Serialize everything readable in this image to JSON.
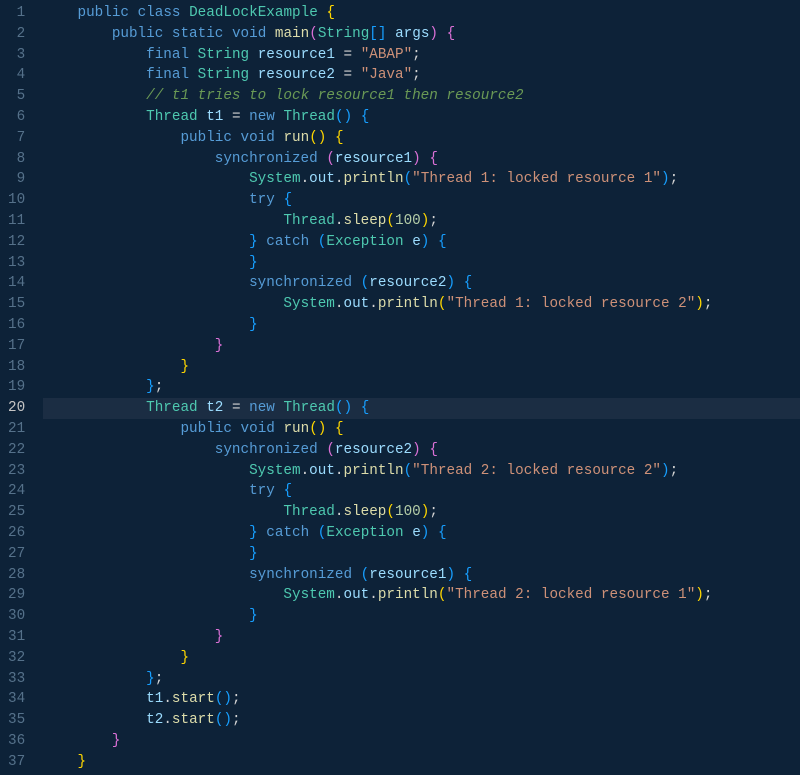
{
  "active_line": 20,
  "lines": [
    {
      "n": 1,
      "indent": 1,
      "tokens": [
        [
          "kw",
          "public"
        ],
        [
          "pn",
          " "
        ],
        [
          "kw",
          "class"
        ],
        [
          "pn",
          " "
        ],
        [
          "cls",
          "DeadLockExample"
        ],
        [
          "pn",
          " "
        ],
        [
          "brc",
          "{"
        ]
      ]
    },
    {
      "n": 2,
      "indent": 2,
      "tokens": [
        [
          "kw",
          "public"
        ],
        [
          "pn",
          " "
        ],
        [
          "kw",
          "static"
        ],
        [
          "pn",
          " "
        ],
        [
          "kw",
          "void"
        ],
        [
          "pn",
          " "
        ],
        [
          "mth",
          "main"
        ],
        [
          "brc2",
          "("
        ],
        [
          "cls",
          "String"
        ],
        [
          "brc3",
          "["
        ],
        [
          "brc3",
          "]"
        ],
        [
          "pn",
          " "
        ],
        [
          "var",
          "args"
        ],
        [
          "brc2",
          ")"
        ],
        [
          "pn",
          " "
        ],
        [
          "brc2",
          "{"
        ]
      ]
    },
    {
      "n": 3,
      "indent": 3,
      "tokens": [
        [
          "kw",
          "final"
        ],
        [
          "pn",
          " "
        ],
        [
          "cls",
          "String"
        ],
        [
          "pn",
          " "
        ],
        [
          "var",
          "resource1"
        ],
        [
          "pn",
          " = "
        ],
        [
          "str",
          "\"ABAP\""
        ],
        [
          "pn",
          ";"
        ]
      ]
    },
    {
      "n": 4,
      "indent": 3,
      "tokens": [
        [
          "kw",
          "final"
        ],
        [
          "pn",
          " "
        ],
        [
          "cls",
          "String"
        ],
        [
          "pn",
          " "
        ],
        [
          "var",
          "resource2"
        ],
        [
          "pn",
          " = "
        ],
        [
          "str",
          "\"Java\""
        ],
        [
          "pn",
          ";"
        ]
      ]
    },
    {
      "n": 5,
      "indent": 3,
      "tokens": [
        [
          "cmt",
          "// t1 tries to lock resource1 then resource2"
        ]
      ]
    },
    {
      "n": 6,
      "indent": 3,
      "tokens": [
        [
          "cls",
          "Thread"
        ],
        [
          "pn",
          " "
        ],
        [
          "var",
          "t1"
        ],
        [
          "pn",
          " = "
        ],
        [
          "kw",
          "new"
        ],
        [
          "pn",
          " "
        ],
        [
          "cls",
          "Thread"
        ],
        [
          "brc3",
          "("
        ],
        [
          "brc3",
          ")"
        ],
        [
          "pn",
          " "
        ],
        [
          "brc3",
          "{"
        ]
      ]
    },
    {
      "n": 7,
      "indent": 4,
      "tokens": [
        [
          "kw",
          "public"
        ],
        [
          "pn",
          " "
        ],
        [
          "kw",
          "void"
        ],
        [
          "pn",
          " "
        ],
        [
          "mth",
          "run"
        ],
        [
          "brc",
          "("
        ],
        [
          "brc",
          ")"
        ],
        [
          "pn",
          " "
        ],
        [
          "brc",
          "{"
        ]
      ]
    },
    {
      "n": 8,
      "indent": 5,
      "tokens": [
        [
          "kw",
          "synchronized"
        ],
        [
          "pn",
          " "
        ],
        [
          "brc2",
          "("
        ],
        [
          "var",
          "resource1"
        ],
        [
          "brc2",
          ")"
        ],
        [
          "pn",
          " "
        ],
        [
          "brc2",
          "{"
        ]
      ]
    },
    {
      "n": 9,
      "indent": 6,
      "tokens": [
        [
          "cls",
          "System"
        ],
        [
          "pn",
          "."
        ],
        [
          "var",
          "out"
        ],
        [
          "pn",
          "."
        ],
        [
          "mth",
          "println"
        ],
        [
          "brc3",
          "("
        ],
        [
          "str",
          "\"Thread 1: locked resource 1\""
        ],
        [
          "brc3",
          ")"
        ],
        [
          "pn",
          ";"
        ]
      ]
    },
    {
      "n": 10,
      "indent": 6,
      "tokens": [
        [
          "kw",
          "try"
        ],
        [
          "pn",
          " "
        ],
        [
          "brc3",
          "{"
        ]
      ]
    },
    {
      "n": 11,
      "indent": 7,
      "tokens": [
        [
          "cls",
          "Thread"
        ],
        [
          "pn",
          "."
        ],
        [
          "mth",
          "sleep"
        ],
        [
          "brc",
          "("
        ],
        [
          "num",
          "100"
        ],
        [
          "brc",
          ")"
        ],
        [
          "pn",
          ";"
        ]
      ]
    },
    {
      "n": 12,
      "indent": 6,
      "tokens": [
        [
          "brc3",
          "}"
        ],
        [
          "pn",
          " "
        ],
        [
          "kw",
          "catch"
        ],
        [
          "pn",
          " "
        ],
        [
          "brc3",
          "("
        ],
        [
          "cls",
          "Exception"
        ],
        [
          "pn",
          " "
        ],
        [
          "var",
          "e"
        ],
        [
          "brc3",
          ")"
        ],
        [
          "pn",
          " "
        ],
        [
          "brc3",
          "{"
        ]
      ]
    },
    {
      "n": 13,
      "indent": 6,
      "tokens": [
        [
          "brc3",
          "}"
        ]
      ]
    },
    {
      "n": 14,
      "indent": 6,
      "tokens": [
        [
          "kw",
          "synchronized"
        ],
        [
          "pn",
          " "
        ],
        [
          "brc3",
          "("
        ],
        [
          "var",
          "resource2"
        ],
        [
          "brc3",
          ")"
        ],
        [
          "pn",
          " "
        ],
        [
          "brc3",
          "{"
        ]
      ]
    },
    {
      "n": 15,
      "indent": 7,
      "tokens": [
        [
          "cls",
          "System"
        ],
        [
          "pn",
          "."
        ],
        [
          "var",
          "out"
        ],
        [
          "pn",
          "."
        ],
        [
          "mth",
          "println"
        ],
        [
          "brc",
          "("
        ],
        [
          "str",
          "\"Thread 1: locked resource 2\""
        ],
        [
          "brc",
          ")"
        ],
        [
          "pn",
          ";"
        ]
      ]
    },
    {
      "n": 16,
      "indent": 6,
      "tokens": [
        [
          "brc3",
          "}"
        ]
      ]
    },
    {
      "n": 17,
      "indent": 5,
      "tokens": [
        [
          "brc2",
          "}"
        ]
      ]
    },
    {
      "n": 18,
      "indent": 4,
      "tokens": [
        [
          "brc",
          "}"
        ]
      ]
    },
    {
      "n": 19,
      "indent": 3,
      "tokens": [
        [
          "brc3",
          "}"
        ],
        [
          "pn",
          ";"
        ]
      ]
    },
    {
      "n": 20,
      "indent": 3,
      "tokens": [
        [
          "cls",
          "Thread"
        ],
        [
          "pn",
          " "
        ],
        [
          "var",
          "t2"
        ],
        [
          "pn",
          " = "
        ],
        [
          "kw",
          "new"
        ],
        [
          "pn",
          " "
        ],
        [
          "cls",
          "Thread"
        ],
        [
          "brc3",
          "("
        ],
        [
          "brc3",
          ")"
        ],
        [
          "pn",
          " "
        ],
        [
          "brc3",
          "{"
        ]
      ]
    },
    {
      "n": 21,
      "indent": 4,
      "tokens": [
        [
          "kw",
          "public"
        ],
        [
          "pn",
          " "
        ],
        [
          "kw",
          "void"
        ],
        [
          "pn",
          " "
        ],
        [
          "mth",
          "run"
        ],
        [
          "brc",
          "("
        ],
        [
          "brc",
          ")"
        ],
        [
          "pn",
          " "
        ],
        [
          "brc",
          "{"
        ]
      ]
    },
    {
      "n": 22,
      "indent": 5,
      "tokens": [
        [
          "kw",
          "synchronized"
        ],
        [
          "pn",
          " "
        ],
        [
          "brc2",
          "("
        ],
        [
          "var",
          "resource2"
        ],
        [
          "brc2",
          ")"
        ],
        [
          "pn",
          " "
        ],
        [
          "brc2",
          "{"
        ]
      ]
    },
    {
      "n": 23,
      "indent": 6,
      "tokens": [
        [
          "cls",
          "System"
        ],
        [
          "pn",
          "."
        ],
        [
          "var",
          "out"
        ],
        [
          "pn",
          "."
        ],
        [
          "mth",
          "println"
        ],
        [
          "brc3",
          "("
        ],
        [
          "str",
          "\"Thread 2: locked resource 2\""
        ],
        [
          "brc3",
          ")"
        ],
        [
          "pn",
          ";"
        ]
      ]
    },
    {
      "n": 24,
      "indent": 6,
      "tokens": [
        [
          "kw",
          "try"
        ],
        [
          "pn",
          " "
        ],
        [
          "brc3",
          "{"
        ]
      ]
    },
    {
      "n": 25,
      "indent": 7,
      "tokens": [
        [
          "cls",
          "Thread"
        ],
        [
          "pn",
          "."
        ],
        [
          "mth",
          "sleep"
        ],
        [
          "brc",
          "("
        ],
        [
          "num",
          "100"
        ],
        [
          "brc",
          ")"
        ],
        [
          "pn",
          ";"
        ]
      ]
    },
    {
      "n": 26,
      "indent": 6,
      "tokens": [
        [
          "brc3",
          "}"
        ],
        [
          "pn",
          " "
        ],
        [
          "kw",
          "catch"
        ],
        [
          "pn",
          " "
        ],
        [
          "brc3",
          "("
        ],
        [
          "cls",
          "Exception"
        ],
        [
          "pn",
          " "
        ],
        [
          "var",
          "e"
        ],
        [
          "brc3",
          ")"
        ],
        [
          "pn",
          " "
        ],
        [
          "brc3",
          "{"
        ]
      ]
    },
    {
      "n": 27,
      "indent": 6,
      "tokens": [
        [
          "brc3",
          "}"
        ]
      ]
    },
    {
      "n": 28,
      "indent": 6,
      "tokens": [
        [
          "kw",
          "synchronized"
        ],
        [
          "pn",
          " "
        ],
        [
          "brc3",
          "("
        ],
        [
          "var",
          "resource1"
        ],
        [
          "brc3",
          ")"
        ],
        [
          "pn",
          " "
        ],
        [
          "brc3",
          "{"
        ]
      ]
    },
    {
      "n": 29,
      "indent": 7,
      "tokens": [
        [
          "cls",
          "System"
        ],
        [
          "pn",
          "."
        ],
        [
          "var",
          "out"
        ],
        [
          "pn",
          "."
        ],
        [
          "mth",
          "println"
        ],
        [
          "brc",
          "("
        ],
        [
          "str",
          "\"Thread 2: locked resource 1\""
        ],
        [
          "brc",
          ")"
        ],
        [
          "pn",
          ";"
        ]
      ]
    },
    {
      "n": 30,
      "indent": 6,
      "tokens": [
        [
          "brc3",
          "}"
        ]
      ]
    },
    {
      "n": 31,
      "indent": 5,
      "tokens": [
        [
          "brc2",
          "}"
        ]
      ]
    },
    {
      "n": 32,
      "indent": 4,
      "tokens": [
        [
          "brc",
          "}"
        ]
      ]
    },
    {
      "n": 33,
      "indent": 3,
      "tokens": [
        [
          "brc3",
          "}"
        ],
        [
          "pn",
          ";"
        ]
      ]
    },
    {
      "n": 34,
      "indent": 3,
      "tokens": [
        [
          "var",
          "t1"
        ],
        [
          "pn",
          "."
        ],
        [
          "mth",
          "start"
        ],
        [
          "brc3",
          "("
        ],
        [
          "brc3",
          ")"
        ],
        [
          "pn",
          ";"
        ]
      ]
    },
    {
      "n": 35,
      "indent": 3,
      "tokens": [
        [
          "var",
          "t2"
        ],
        [
          "pn",
          "."
        ],
        [
          "mth",
          "start"
        ],
        [
          "brc3",
          "("
        ],
        [
          "brc3",
          ")"
        ],
        [
          "pn",
          ";"
        ]
      ]
    },
    {
      "n": 36,
      "indent": 2,
      "tokens": [
        [
          "brc2",
          "}"
        ]
      ]
    },
    {
      "n": 37,
      "indent": 1,
      "tokens": [
        [
          "brc",
          "}"
        ]
      ]
    }
  ]
}
